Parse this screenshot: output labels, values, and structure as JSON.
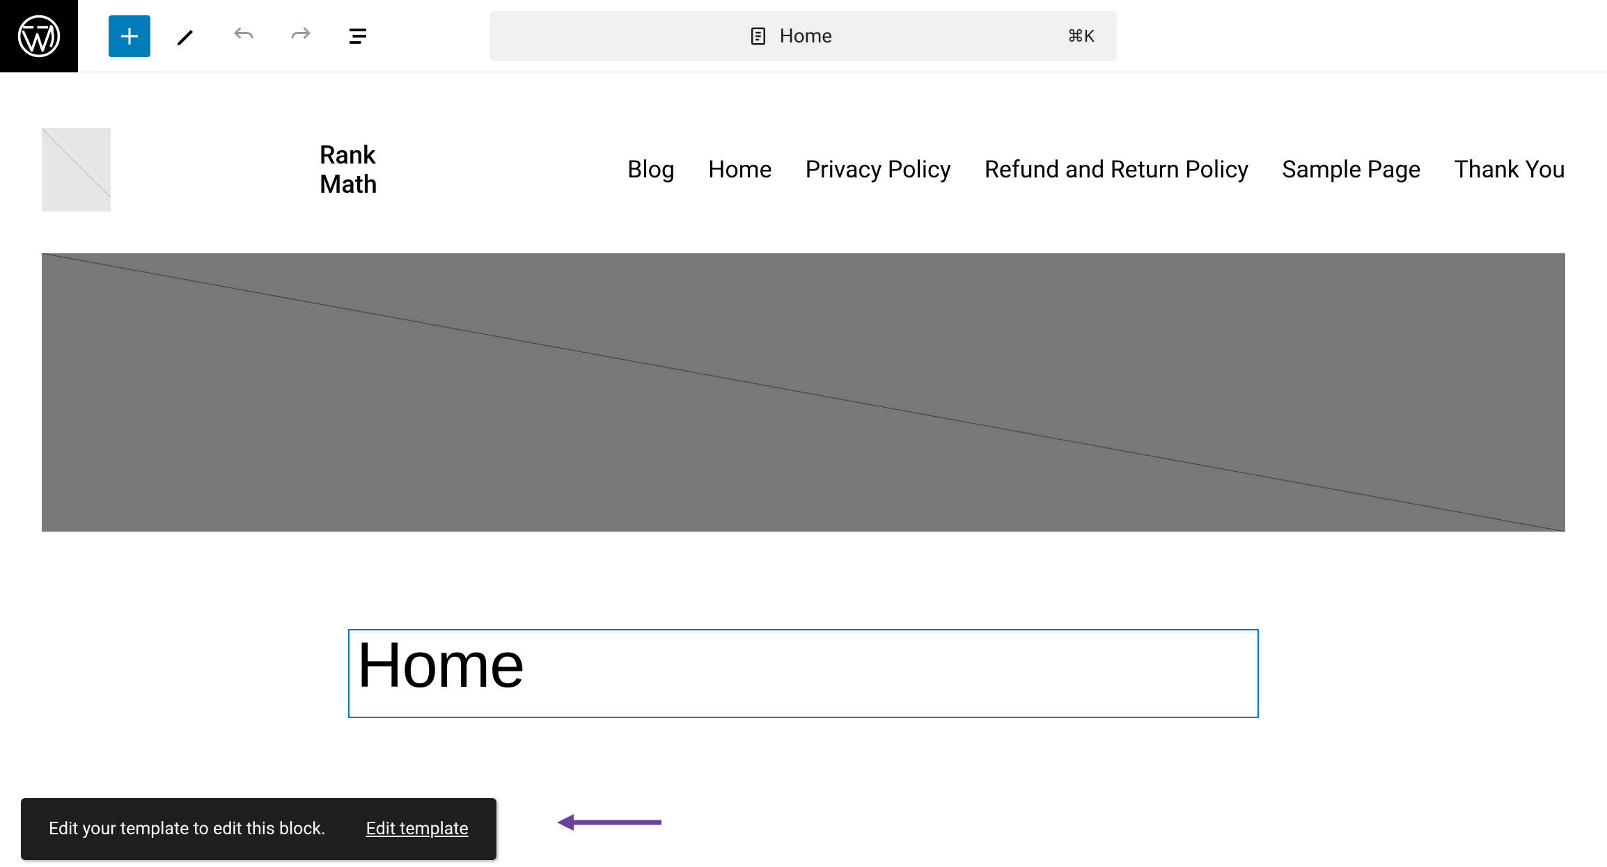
{
  "toolbar": {
    "doc_title": "Home",
    "shortcut": "⌘K"
  },
  "site": {
    "title": "Rank Math"
  },
  "nav": {
    "items": [
      "Blog",
      "Home",
      "Privacy Policy",
      "Refund and Return Policy",
      "Sample Page",
      "Thank You"
    ]
  },
  "page": {
    "title": "Home"
  },
  "snackbar": {
    "message": "Edit your template to edit this block.",
    "action": "Edit template"
  }
}
